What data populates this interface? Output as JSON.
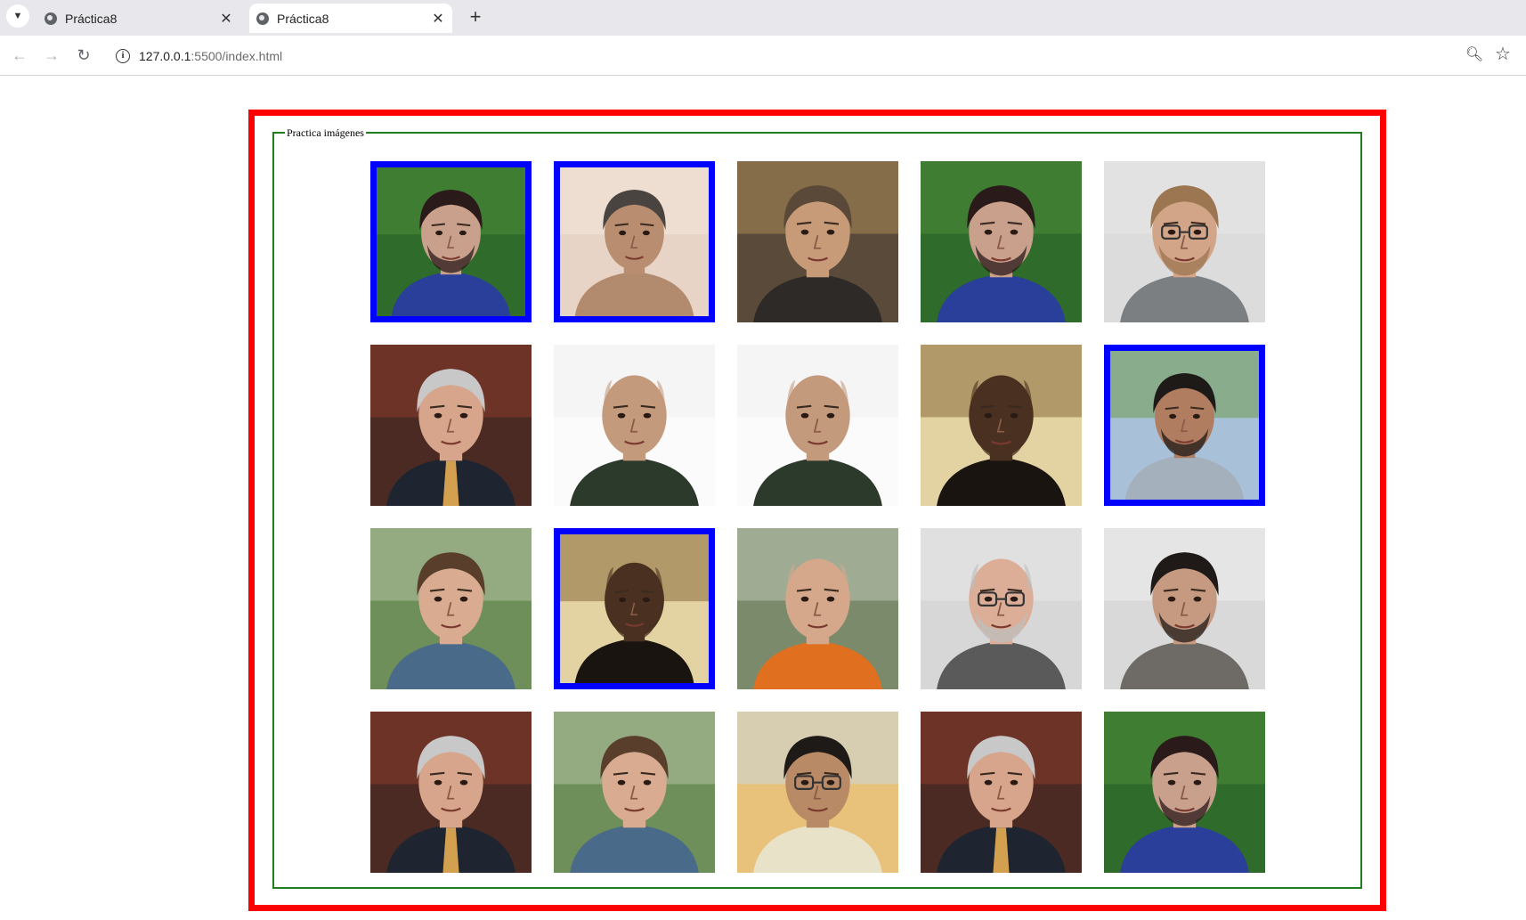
{
  "browser": {
    "tabs": [
      {
        "title": "Práctica8",
        "active": false
      },
      {
        "title": "Práctica8",
        "active": true
      }
    ],
    "url_host": "127.0.0.1",
    "url_path": ":5500/index.html",
    "icons": {
      "tab_menu": "chevron-down-icon",
      "favicon": "globe-icon",
      "close": "close-icon",
      "new_tab": "plus-icon",
      "back": "arrow-left-icon",
      "forward": "arrow-right-icon",
      "reload": "reload-icon",
      "site_info": "info-icon",
      "zoom": "zoom-icon",
      "bookmark": "star-icon"
    }
  },
  "page": {
    "legend": "Practica imágenes",
    "colors": {
      "outer_border": "#ff0000",
      "fieldset_border": "#1e7d1e",
      "selected_border": "#0000ff"
    },
    "images": [
      {
        "person": "man-leaves-blue-shirt",
        "selected": true
      },
      {
        "person": "man-grey-hair-hand",
        "selected": true
      },
      {
        "person": "man-night-lights",
        "selected": false
      },
      {
        "person": "man-leaves-blue-shirt",
        "selected": false
      },
      {
        "person": "man-glasses-plaid",
        "selected": false
      },
      {
        "person": "man-suit-library",
        "selected": false
      },
      {
        "person": "man-bald-white-bg",
        "selected": false
      },
      {
        "person": "man-bald-white-bg",
        "selected": false
      },
      {
        "person": "man-bald-beard-dark",
        "selected": false
      },
      {
        "person": "man-outdoor-sweater",
        "selected": true
      },
      {
        "person": "man-young-park",
        "selected": false
      },
      {
        "person": "man-bald-beard-dark",
        "selected": true
      },
      {
        "person": "man-bald-outdoor",
        "selected": false
      },
      {
        "person": "man-older-glasses",
        "selected": false
      },
      {
        "person": "man-beard-grey-shirt",
        "selected": false
      },
      {
        "person": "man-suit-library",
        "selected": false
      },
      {
        "person": "man-young-park",
        "selected": false
      },
      {
        "person": "man-glasses-closeup",
        "selected": false
      },
      {
        "person": "man-suit-library",
        "selected": false
      },
      {
        "person": "man-leaves-blue-shirt",
        "selected": false
      }
    ]
  }
}
